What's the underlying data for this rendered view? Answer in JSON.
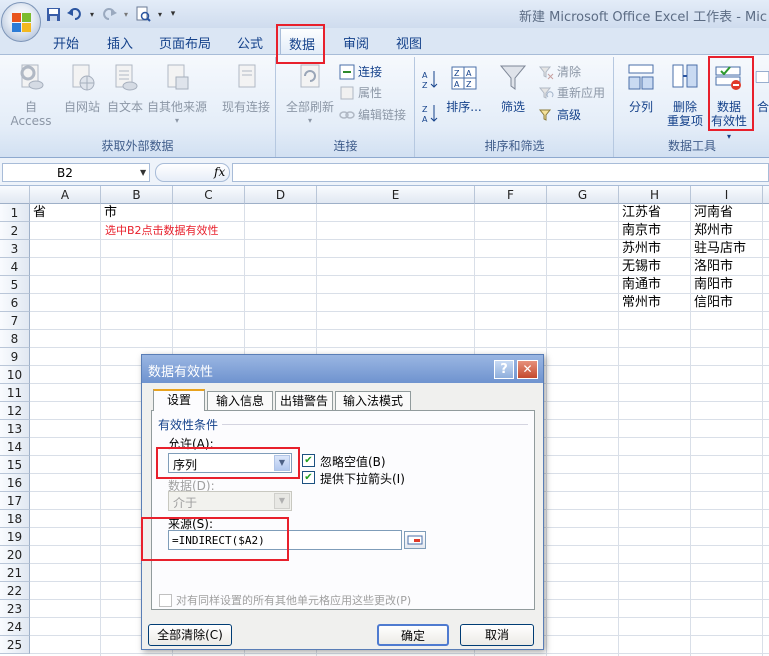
{
  "window": {
    "title": "新建 Microsoft Office Excel 工作表 - Mic",
    "colors": {
      "accent": "#15428b",
      "highlight_red": "#e8202c",
      "ribbon_bg": "#dbe6f4"
    }
  },
  "qat": {
    "icons": [
      "save-icon",
      "undo-icon",
      "redo-icon",
      "print-preview-icon",
      "customize-qat-icon"
    ]
  },
  "tabs": [
    {
      "label": "开始"
    },
    {
      "label": "插入"
    },
    {
      "label": "页面布局"
    },
    {
      "label": "公式"
    },
    {
      "label": "数据",
      "active": true
    },
    {
      "label": "审阅"
    },
    {
      "label": "视图"
    }
  ],
  "ribbon": {
    "get_external": {
      "label": "获取外部数据",
      "buttons": [
        "自 Access",
        "自网站",
        "自文本",
        "自其他来源",
        "现有连接"
      ]
    },
    "connections": {
      "label": "连接",
      "refresh_all": "全部刷新",
      "small": [
        "连接",
        "属性",
        "编辑链接"
      ]
    },
    "sort_filter": {
      "label": "排序和筛选",
      "sort": "排序...",
      "filter": "筛选",
      "small": [
        "清除",
        "重新应用",
        "高级"
      ]
    },
    "data_tools": {
      "label": "数据工具",
      "split": "分列",
      "remove_dup_line1": "删除",
      "remove_dup_line2": "重复项",
      "validation_line1": "数据",
      "validation_line2": "有效性",
      "validation_arrow": "▾",
      "merge": "合"
    }
  },
  "formula_bar": {
    "name_box": "B2",
    "fx": "fx",
    "formula": ""
  },
  "grid": {
    "columns": [
      "A",
      "B",
      "C",
      "D",
      "E",
      "F",
      "G",
      "H",
      "I"
    ],
    "rows": [
      "1",
      "2",
      "3",
      "4",
      "5",
      "6",
      "7",
      "8",
      "9",
      "10",
      "11",
      "12",
      "13",
      "14",
      "15",
      "16",
      "17",
      "18",
      "19",
      "20",
      "21",
      "22",
      "23",
      "24",
      "25"
    ],
    "cells": {
      "A1": "省",
      "B1": "市",
      "B2": "选中B2点击数据有效性",
      "H": [
        "江苏省",
        "南京市",
        "苏州市",
        "无锡市",
        "南通市",
        "常州市"
      ],
      "I": [
        "河南省",
        "郑州市",
        "驻马店市",
        "洛阳市",
        "南阳市",
        "信阳市"
      ]
    }
  },
  "dialog": {
    "title": "数据有效性",
    "help": "?",
    "close": "✕",
    "tabs": [
      "设置",
      "输入信息",
      "出错警告",
      "输入法模式"
    ],
    "criteria_label": "有效性条件",
    "allow_label": "允许(A):",
    "allow_value": "序列",
    "ignore_blank": "忽略空值(B)",
    "dropdown_arrow": "提供下拉箭头(I)",
    "data_label": "数据(D):",
    "data_value": "介于",
    "source_label": "来源(S):",
    "source_value": "=INDIRECT($A2)",
    "apply_all": "对有同样设置的所有其他单元格应用这些更改(P)",
    "clear_all": "全部清除(C)",
    "ok": "确定",
    "cancel": "取消"
  }
}
